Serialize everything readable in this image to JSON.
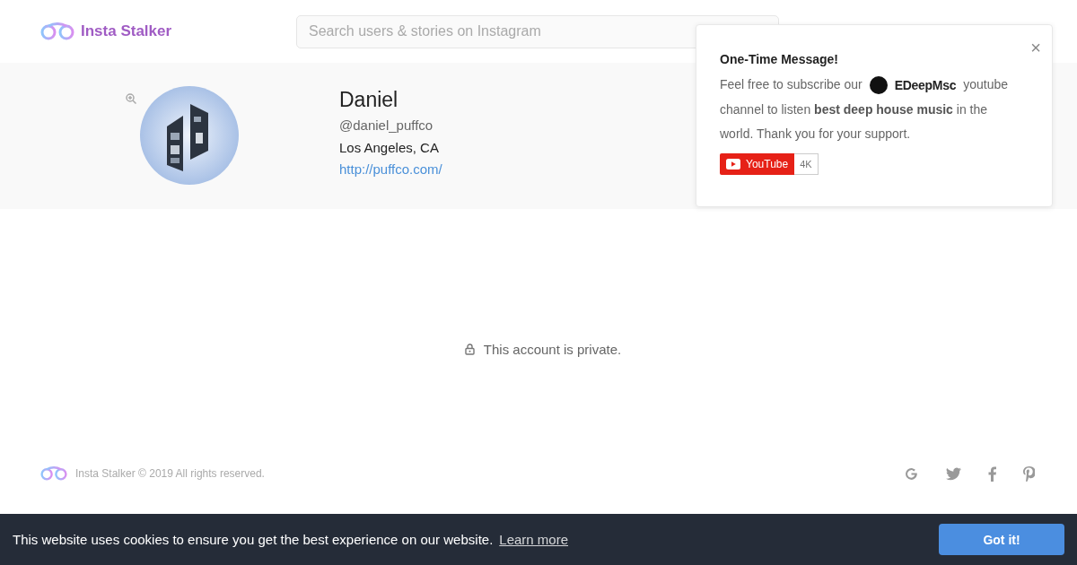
{
  "header": {
    "logo_text": "Insta Stalker",
    "search": {
      "placeholder": "Search users & stories on Instagram"
    }
  },
  "profile": {
    "name": "Daniel",
    "username": "@daniel_puffco",
    "location": "Los Angeles, CA",
    "website": "http://puffco.com/"
  },
  "private_message": "This account is private.",
  "footer": {
    "copyright": "Insta Stalker © 2019 All rights reserved."
  },
  "popup": {
    "title": "One-Time Message!",
    "close": "×",
    "intro": "Feel free to subscribe our",
    "channel": "EDeepMsc",
    "body_start": "youtube",
    "body": "channel to listen **best deep house music** in the world. Thank you for your support.",
    "youtube_label": "YouTube",
    "subscriber_count": "4K"
  },
  "cookie_bar": {
    "message": "This website uses cookies to ensure you get the best experience on our website.",
    "link": "Learn more",
    "button": "Got it!"
  }
}
